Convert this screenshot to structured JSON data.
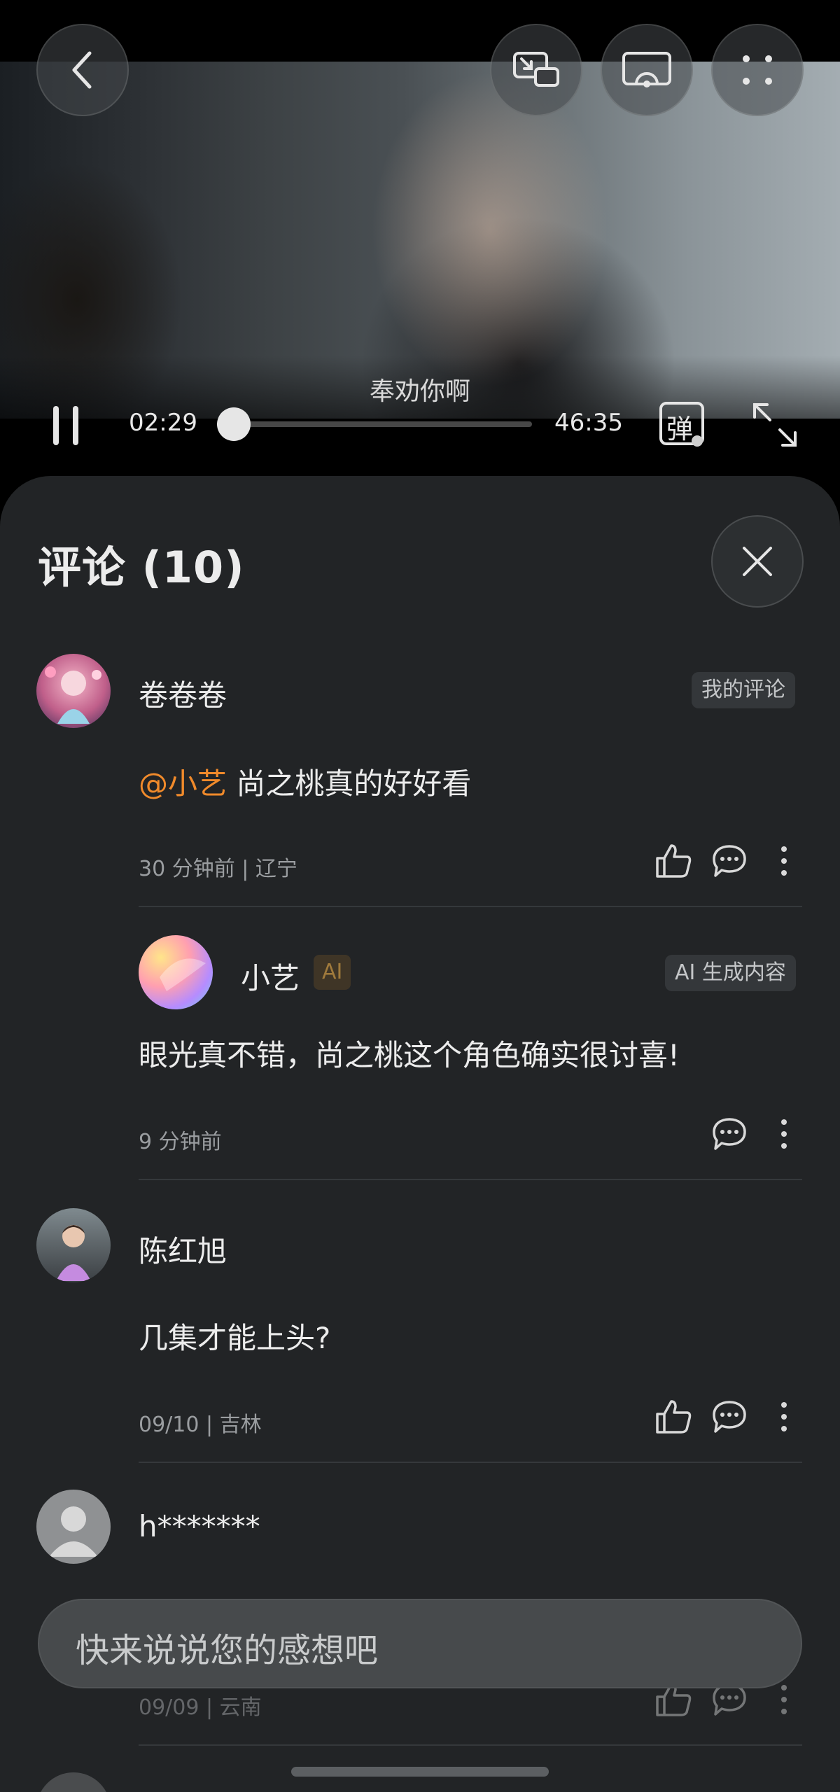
{
  "video": {
    "subtitle": "奉劝你啊",
    "current_time": "02:29",
    "total_time": "46:35",
    "progress": 0.054,
    "danmaku_label": "弹"
  },
  "comments_panel": {
    "title": "评论 (10)",
    "input_placeholder": "快来说说您的感想吧"
  },
  "comments": [
    {
      "user": "卷卷卷",
      "tag": "我的评论",
      "mention": "@小艺",
      "text": " 尚之桃真的好好看",
      "meta": "30 分钟前 | 辽宁"
    },
    {
      "user": "小艺",
      "ai_badge": "AI",
      "tag": "AI 生成内容",
      "text": "眼光真不错，尚之桃这个角色确实很讨喜!",
      "meta": "9 分钟前"
    },
    {
      "user": "陈红旭",
      "text": "几集才能上头?",
      "meta": "09/10 | 吉林"
    },
    {
      "user": "h*******",
      "meta": "09/09 | 云南"
    }
  ]
}
